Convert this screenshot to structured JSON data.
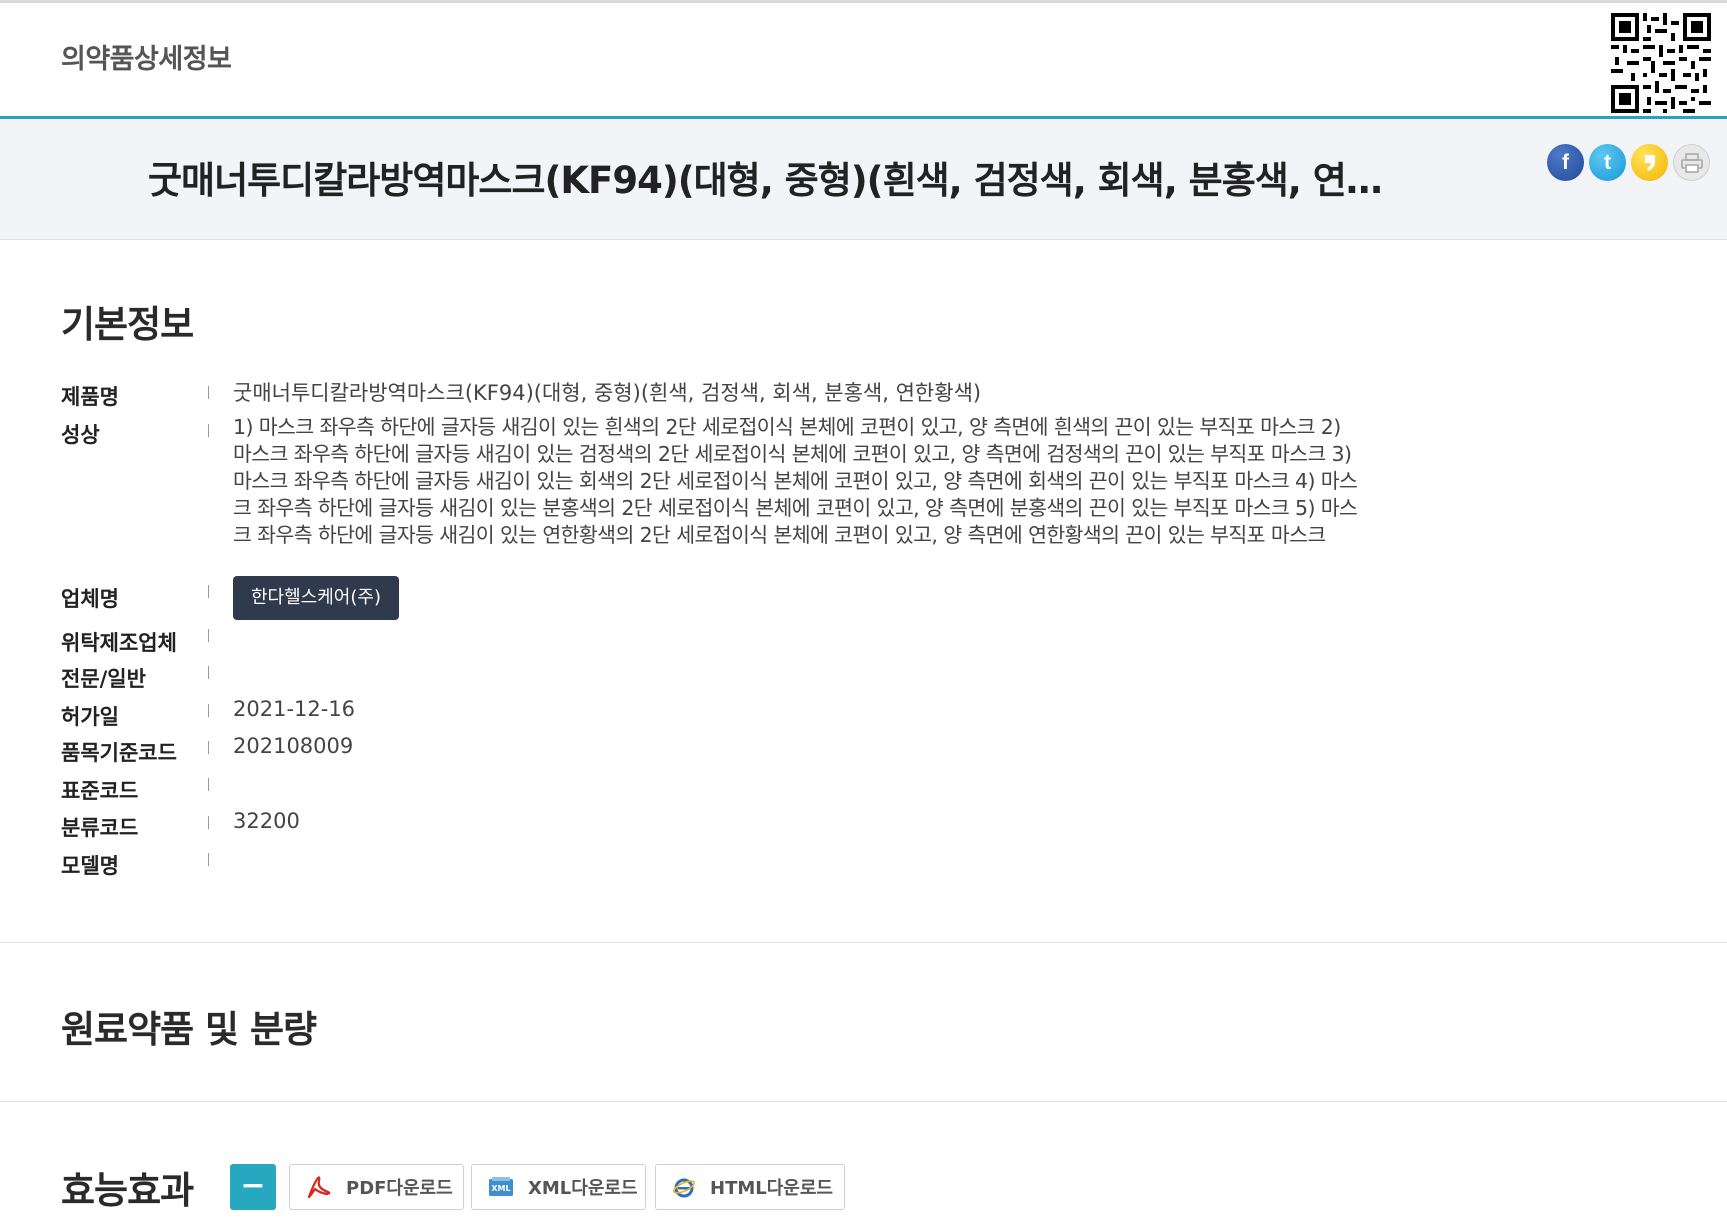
{
  "header": {
    "site_title": "의약품상세정보"
  },
  "title_band": {
    "product_title": "굿매너투디칼라방역마스크(KF94)(대형, 중형)(흰색, 검정색, 회색, 분홍색, 연한황색)",
    "share_icons": [
      "facebook-icon",
      "twitter-icon",
      "kakaostory-icon",
      "print-icon"
    ]
  },
  "basic_info": {
    "section_title": "기본정보",
    "fields": {
      "product_name": {
        "label": "제품명",
        "value": "굿매너투디칼라방역마스크(KF94)(대형, 중형)(흰색, 검정색, 회색, 분홍색, 연한황색)"
      },
      "appearance": {
        "label": "성상",
        "value": "1) 마스크 좌우측 하단에 글자등 새김이 있는 흰색의 2단 세로접이식 본체에 코편이 있고, 양 측면에 흰색의 끈이 있는 부직포 마스크 2) 마스크 좌우측 하단에 글자등 새김이 있는 검정색의 2단 세로접이식 본체에 코편이 있고, 양 측면에 검정색의 끈이 있는 부직포 마스크 3) 마스크 좌우측 하단에 글자등 새김이 있는 회색의 2단 세로접이식 본체에 코편이 있고, 양 측면에 회색의 끈이 있는 부직포 마스크 4) 마스크 좌우측 하단에 글자등 새김이 있는 분홍색의 2단 세로접이식 본체에 코편이 있고, 양 측면에 분홍색의 끈이 있는 부직포 마스크 5) 마스크 좌우측 하단에 글자등 새김이 있는 연한황색의 2단 세로접이식 본체에 코편이 있고, 양 측면에 연한황색의 끈이 있는 부직포 마스크"
      },
      "company": {
        "label": "업체명",
        "value": "한다헬스케어(주)"
      },
      "contract_manufacturer": {
        "label": "위탁제조업체",
        "value": ""
      },
      "prescription_type": {
        "label": "전문/일반",
        "value": ""
      },
      "approval_date": {
        "label": "허가일",
        "value": "2021-12-16"
      },
      "item_code": {
        "label": "품목기준코드",
        "value": "202108009"
      },
      "standard_code": {
        "label": "표준코드",
        "value": ""
      },
      "class_code": {
        "label": "분류코드",
        "value": "32200"
      },
      "model_name": {
        "label": "모델명",
        "value": ""
      }
    }
  },
  "ingredients": {
    "section_title": "원료약품 및 분량"
  },
  "efficacy": {
    "section_title": "효능효과",
    "toggle_label": "−",
    "pdf_label": "PDF다운로드",
    "xml_label": "XML다운로드",
    "html_label": "HTML다운로드"
  },
  "colors": {
    "accent": "#27a8c1",
    "company_button": "#2f3a4c"
  }
}
